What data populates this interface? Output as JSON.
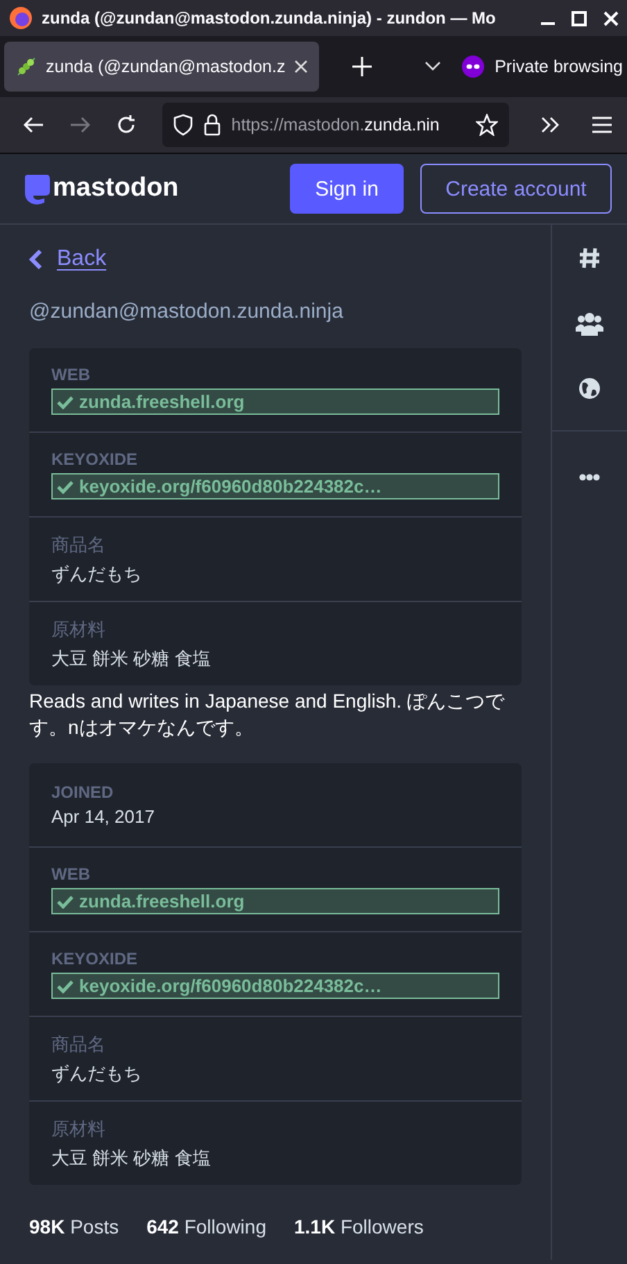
{
  "window": {
    "title": "zunda (@zundan@mastodon.zunda.ninja) - zundon — Mo"
  },
  "tabs": [
    {
      "label": "zunda (@zundan@mastodon.z",
      "selected": true
    }
  ],
  "private_label": "Private browsing",
  "address_bar": {
    "url_prefix": "https://mastodon.",
    "url_domain": "zunda.nin"
  },
  "header": {
    "logo_text": "mastodon",
    "sign_in": "Sign in",
    "create_account": "Create account"
  },
  "back_link": "Back",
  "handle": "@zundan@mastodon.zunda.ninja",
  "field_cards": [
    {
      "fields": [
        {
          "label": "WEB",
          "value": "zunda.freeshell.org",
          "verified": true
        },
        {
          "label": "KEYOXIDE",
          "value": "keyoxide.org/f60960d80b224382c…",
          "verified": true
        },
        {
          "label": "商品名",
          "value": "ずんだもち",
          "verified": false
        },
        {
          "label": "原材料",
          "value": "大豆 餅米 砂糖 食塩",
          "verified": false
        }
      ]
    },
    {
      "fields": [
        {
          "label": "JOINED",
          "value": "Apr 14, 2017",
          "verified": false
        },
        {
          "label": "WEB",
          "value": "zunda.freeshell.org",
          "verified": true
        },
        {
          "label": "KEYOXIDE",
          "value": "keyoxide.org/f60960d80b224382c…",
          "verified": true
        },
        {
          "label": "商品名",
          "value": "ずんだもち",
          "verified": false
        },
        {
          "label": "原材料",
          "value": "大豆 餅米 砂糖 食塩",
          "verified": false
        }
      ]
    }
  ],
  "bio": "Reads and writes in Japanese and English. ぽんこつです。nはオマケなんです。",
  "stats": [
    {
      "count": "98K",
      "label": "Posts"
    },
    {
      "count": "642",
      "label": "Following"
    },
    {
      "count": "1.1K",
      "label": "Followers"
    }
  ]
}
